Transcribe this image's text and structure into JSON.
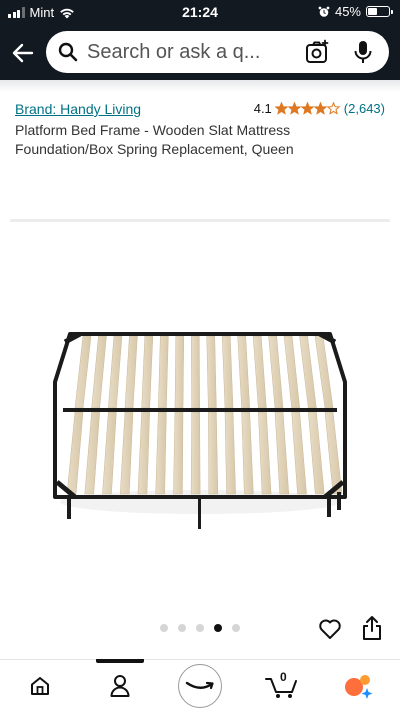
{
  "status_bar": {
    "carrier": "Mint",
    "time": "21:24",
    "battery": "45%",
    "battery_level": 0.45
  },
  "search": {
    "placeholder": "Search or ask a q..."
  },
  "product": {
    "brand": "Brand: Handy Living",
    "rating_value": "4.1",
    "stars": 4.1,
    "rating_count": "(2,643)",
    "title": "Platform Bed Frame - Wooden Slat Mattress Foundation/Box Spring Replacement, Queen"
  },
  "carousel": {
    "total": 5,
    "active_index": 3
  },
  "tabbar": {
    "cart_count": "0"
  },
  "colors": {
    "header_bg": "#131921",
    "link": "#007185",
    "star": "#de7921"
  }
}
